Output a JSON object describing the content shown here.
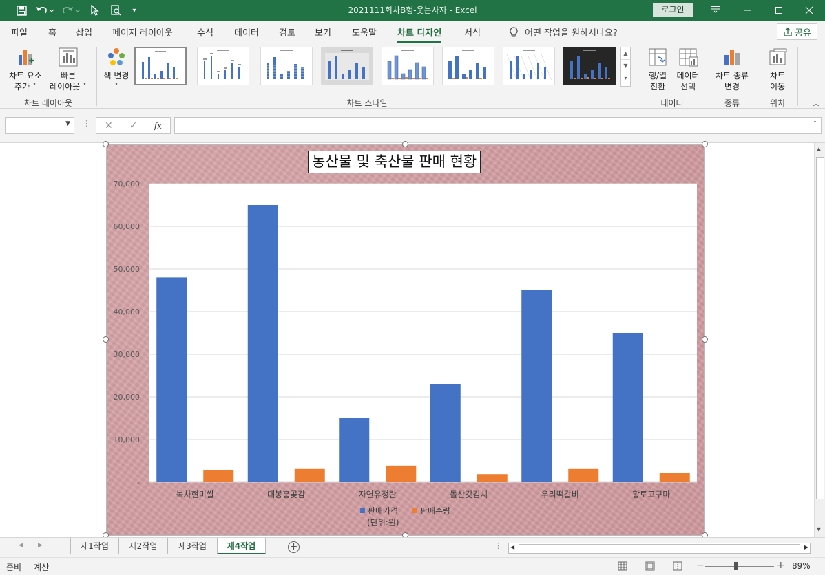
{
  "window": {
    "doc_title": "2021111회차B형-웃는사자  -  Excel",
    "login_label": "로그인"
  },
  "ribbon_tabs": [
    "파일",
    "홈",
    "삽입",
    "페이지 레이아웃",
    "수식",
    "데이터",
    "검토",
    "보기",
    "도움말",
    "차트 디자인",
    "서식"
  ],
  "active_tab": "차트 디자인",
  "tell_me": "어떤 작업을 원하시나요?",
  "share_label": "공유",
  "ribbon": {
    "add_element": [
      "차트 요소",
      "추가 ˅"
    ],
    "quick_layout": [
      "빠른",
      "레이아웃 ˅"
    ],
    "change_colors": [
      "색 변경",
      "˅"
    ],
    "switch_row_col": [
      "행/열",
      "전환"
    ],
    "select_data": [
      "데이터",
      "선택"
    ],
    "change_type": [
      "차트 종류",
      "변경"
    ],
    "move_chart": [
      "차트",
      "이동"
    ],
    "groups": {
      "layouts": "차트 레이아웃",
      "styles": "차트 스타일",
      "data": "데이터",
      "type": "종류",
      "location": "위치"
    }
  },
  "formula_bar": {
    "name_box": "",
    "formula": "",
    "fx_label": "fx"
  },
  "chart_data": {
    "type": "bar",
    "title": "농산물 및 축산물 판매 현황",
    "categories": [
      "녹차현미쌀",
      "대봉홍곶감",
      "자연유정란",
      "돌산갓김치",
      "우리떡갈비",
      "황토고구마"
    ],
    "series": [
      {
        "name": "판매가격\n(단위:원)",
        "name_lines": [
          "판매가격",
          "(단위:원)"
        ],
        "values": [
          48000,
          65000,
          15000,
          23000,
          45000,
          35000
        ],
        "color": "#4472C4"
      },
      {
        "name": "판매수량",
        "name_lines": [
          "판매수량"
        ],
        "values": [
          2900,
          3100,
          3900,
          1900,
          3100,
          2100
        ],
        "color": "#ED7D31"
      }
    ],
    "ylim": [
      0,
      70000
    ],
    "yticks": [
      "-",
      "10,000",
      "20,000",
      "30,000",
      "40,000",
      "50,000",
      "60,000",
      "70,000"
    ],
    "grid": true,
    "legend": "bottom"
  },
  "sheet_tabs": [
    "제1작업",
    "제2작업",
    "제3작업",
    "제4작업"
  ],
  "active_sheet": "제4작업",
  "status": {
    "ready": "준비",
    "calc": "계산",
    "zoom": "89%"
  }
}
